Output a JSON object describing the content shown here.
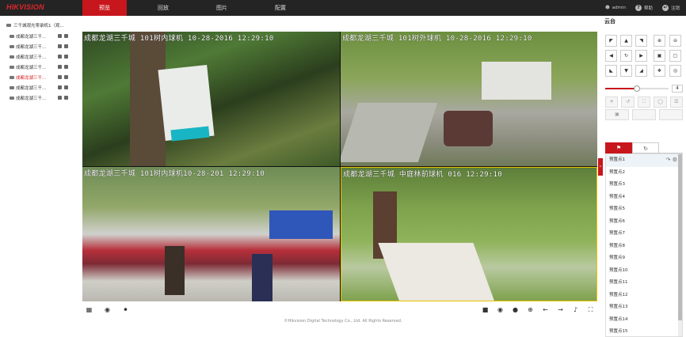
{
  "logo": "HIKVISION",
  "nav": {
    "items": [
      {
        "label": "预览",
        "active": true
      },
      {
        "label": "回放",
        "active": false
      },
      {
        "label": "图片",
        "active": false
      },
      {
        "label": "配置",
        "active": false
      }
    ]
  },
  "user": {
    "name": "admin",
    "help": "帮助",
    "logout": "注销"
  },
  "tree": {
    "root": "三千城观光零录机1（观...",
    "items": [
      {
        "label": "成都龙湖三千...",
        "highlight": false
      },
      {
        "label": "成都龙湖三千...",
        "highlight": false
      },
      {
        "label": "成都龙湖三千...",
        "highlight": false
      },
      {
        "label": "成都龙湖三千...",
        "highlight": false
      },
      {
        "label": "成都龙湖三千...",
        "highlight": true
      },
      {
        "label": "成都龙湖三千...",
        "highlight": false
      },
      {
        "label": "成都龙湖三千...",
        "highlight": false
      }
    ]
  },
  "video": {
    "cells": [
      {
        "osd": "成都龙湖三千城   101树内球机  10-28-2016 12:29:10"
      },
      {
        "osd": "成都龙湖三千城   101树外球机 10-28-2016 12:29:10"
      },
      {
        "osd": "成都龙湖三千城   101树内球机10-28-201  12:29:10"
      },
      {
        "osd": "成都龙湖三千城   中庭林前球机  016 12:29:10"
      }
    ]
  },
  "ptz": {
    "title": "云台",
    "speed_value": "4",
    "speed_fraction": 0.5,
    "tabs": [
      "preset-tab",
      "patrol-tab"
    ],
    "presets": [
      "预置点1",
      "预置点2",
      "预置点3",
      "预置点4",
      "预置点5",
      "预置点6",
      "预置点7",
      "预置点8",
      "预置点9",
      "预置点10",
      "预置点11",
      "预置点12",
      "预置点13",
      "预置点14",
      "预置点15"
    ]
  },
  "footer": "©Hikvision Digital Technology Co., Ltd. All Rights Reserved.",
  "colors": {
    "accent": "#c8161d",
    "topbar": "#242424",
    "selected_border": "#e8c300"
  }
}
